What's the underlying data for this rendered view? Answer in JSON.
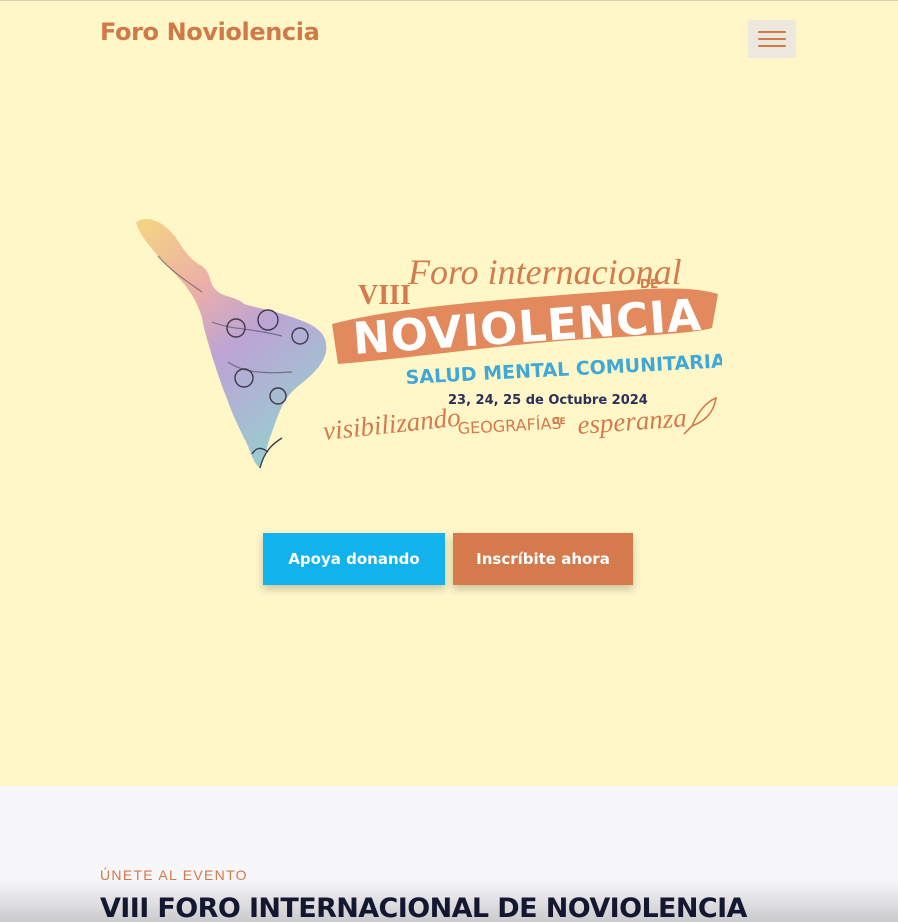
{
  "brand": {
    "name": "Foro Noviolencia"
  },
  "nav": {
    "menu_icon": "hamburger-icon"
  },
  "hero": {
    "logo": {
      "edition": "VIII",
      "title_script": "Foro internacional",
      "title_de": "DE",
      "title_main": "NOVIOLENCIA",
      "theme": "SALUD MENTAL COMUNITARIA",
      "dates": "23, 24, 25 de Octubre 2024",
      "tagline_1": "visibilizando",
      "tagline_2": "GEOGRAFÍAS",
      "tagline_de": "DE",
      "tagline_3": "esperanza"
    },
    "buttons": {
      "donate_label": "Apoya donando",
      "register_label": "Inscríbite ahora"
    }
  },
  "section": {
    "eyebrow": "ÚNETE AL EVENTO",
    "title_prefix": "VIII FORO INTERNACIONAL DE ",
    "title_highlight": "NOVIOLENCIA"
  },
  "colors": {
    "background": "#fff7c8",
    "brand": "#d07a4a",
    "donate": "#12b3ec",
    "register": "#d57a4c",
    "section_bg": "#f7f6f8",
    "title_dark": "#161a36",
    "theme_blue": "#3fa8d8",
    "dates_navy": "#2c2f5c"
  }
}
